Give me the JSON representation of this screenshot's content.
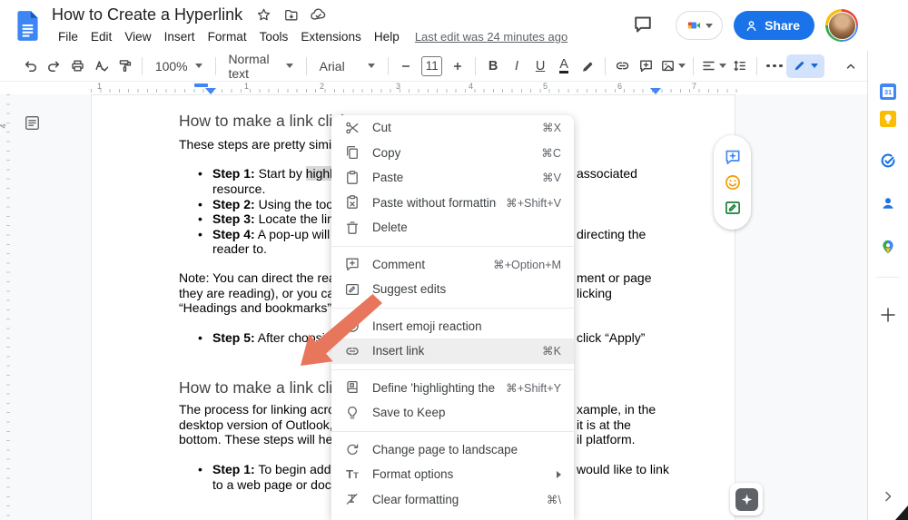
{
  "header": {
    "title": "How to Create a Hyperlink",
    "menu_items": [
      "File",
      "Edit",
      "View",
      "Insert",
      "Format",
      "Tools",
      "Extensions",
      "Help"
    ],
    "last_edit": "Last edit was 24 minutes ago",
    "share_label": "Share"
  },
  "toolbar": {
    "zoom": "100%",
    "paragraph_style": "Normal text",
    "font": "Arial",
    "font_size": "11",
    "glyphs": {
      "bold": "B",
      "italic": "I",
      "underline": "U",
      "text_color": "A"
    }
  },
  "ruler": {
    "marks": [
      "1",
      "1",
      "2",
      "3",
      "4",
      "5",
      "6",
      "7"
    ],
    "vertical_mark": "4"
  },
  "doc": {
    "h1": "How to make a link click",
    "intro": "These steps are pretty similar",
    "b1_bold": "Step 1:",
    "b1_a": " Start by ",
    "b1_hl": "highlig",
    "b1_cont": "resource.",
    "b2_bold": "Step 2:",
    "b2_text": " Using the toolb",
    "b3_bold": "Step 3:",
    "b3_text": " Locate the link",
    "b4_bold": "Step 4:",
    "b4_text": " A pop-up will a",
    "b4_cont": "reader to.",
    "note1": "Note: You can direct the reade",
    "note2": "they are reading), or you can c",
    "note3": "“Headings and bookmarks” in",
    "b5_bold": "Step 5:",
    "b5_text": " After choosing",
    "h2": "How to make a link click",
    "p2a": "The process for linking across",
    "p2b": "desktop version of Outlook, th",
    "p2c": "bottom. These steps will help",
    "b6_bold": "Step 1:",
    "b6_text": " To begin addin",
    "b6_cont": "to a web page or docu",
    "frags": {
      "f1": "associated",
      "f2": "directing the",
      "f3": "ment or page",
      "f4": "licking",
      "f5": "click “Apply”",
      "f6": "xample, in the",
      "f7": "it is at the",
      "f8": "il platform.",
      "f9": "would like to link"
    }
  },
  "context_menu": {
    "glyph_T": "T",
    "items": [
      {
        "icon": "scissors",
        "label": "Cut",
        "shortcut": "⌘X"
      },
      {
        "icon": "copy",
        "label": "Copy",
        "shortcut": "⌘C"
      },
      {
        "icon": "clipboard",
        "label": "Paste",
        "shortcut": "⌘V"
      },
      {
        "icon": "clipboard-plain",
        "label": "Paste without formatting",
        "shortcut": "⌘+Shift+V"
      },
      {
        "icon": "trash",
        "label": "Delete",
        "shortcut": ""
      },
      {
        "icon": "comment-add",
        "label": "Comment",
        "shortcut": "⌘+Option+M"
      },
      {
        "icon": "suggest-edits",
        "label": "Suggest edits",
        "shortcut": ""
      },
      {
        "icon": "emoji",
        "label": "Insert emoji reaction",
        "shortcut": ""
      },
      {
        "icon": "link",
        "label": "Insert link",
        "shortcut": "⌘K"
      },
      {
        "icon": "define",
        "label": "Define 'highlighting the te...'",
        "shortcut": "⌘+Shift+Y"
      },
      {
        "icon": "keep-bulb",
        "label": "Save to Keep",
        "shortcut": ""
      },
      {
        "icon": "rotate-page",
        "label": "Change page to landscape",
        "shortcut": ""
      },
      {
        "icon": "format-options",
        "label": "Format options",
        "shortcut": ""
      },
      {
        "icon": "clear-formatting",
        "label": "Clear formatting",
        "shortcut": "⌘\\"
      }
    ]
  },
  "side_panel": {
    "calendar_day": "31"
  },
  "colors": {
    "accent_blue": "#1a73e8",
    "arrow": "#e8765c",
    "selection_highlight": "#d9d9d9",
    "menu_highlight": "#eeeeee",
    "share_button": "#1a73e8"
  }
}
